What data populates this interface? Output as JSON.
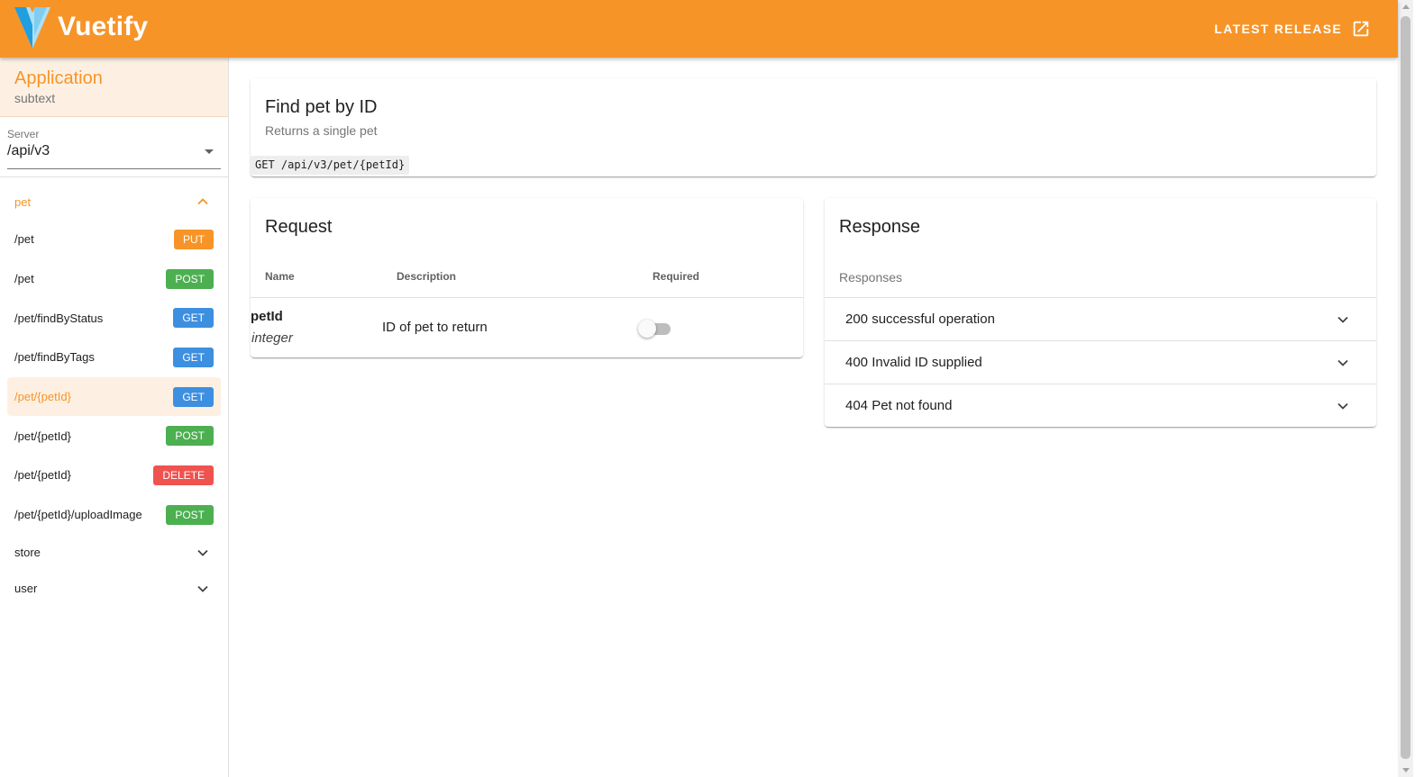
{
  "colors": {
    "primary": "#f79428",
    "get": "#3d8fe0",
    "post": "#4caf50",
    "put": "#f79428",
    "delete": "#ef5350"
  },
  "appbar": {
    "brand": "Vuetify",
    "release_label": "LATEST RELEASE",
    "logo_icon": "vuetify-logo-icon",
    "release_icon": "open-in-new-icon"
  },
  "sidebar": {
    "app_title": "Application",
    "app_subtitle": "subtext",
    "server_label": "Server",
    "server_value": "/api/v3",
    "groups": [
      {
        "name": "pet",
        "expanded": true,
        "endpoints": [
          {
            "path": "/pet",
            "method": "PUT"
          },
          {
            "path": "/pet",
            "method": "POST"
          },
          {
            "path": "/pet/findByStatus",
            "method": "GET"
          },
          {
            "path": "/pet/findByTags",
            "method": "GET"
          },
          {
            "path": "/pet/{petId}",
            "method": "GET",
            "active": true
          },
          {
            "path": "/pet/{petId}",
            "method": "POST"
          },
          {
            "path": "/pet/{petId}",
            "method": "DELETE"
          },
          {
            "path": "/pet/{petId}/uploadImage",
            "method": "POST"
          }
        ]
      },
      {
        "name": "store",
        "expanded": false
      },
      {
        "name": "user",
        "expanded": false
      }
    ]
  },
  "operation": {
    "title": "Find pet by ID",
    "description": "Returns a single pet",
    "path": "GET /api/v3/pet/{petId}"
  },
  "request": {
    "title": "Request",
    "columns": [
      "Name",
      "Description",
      "Required"
    ],
    "params": [
      {
        "name": "petId",
        "type": "integer",
        "description": "ID of pet to return",
        "required": false
      }
    ]
  },
  "response": {
    "title": "Response",
    "label": "Responses",
    "items": [
      "200 successful operation",
      "400 Invalid ID supplied",
      "404 Pet not found"
    ]
  }
}
